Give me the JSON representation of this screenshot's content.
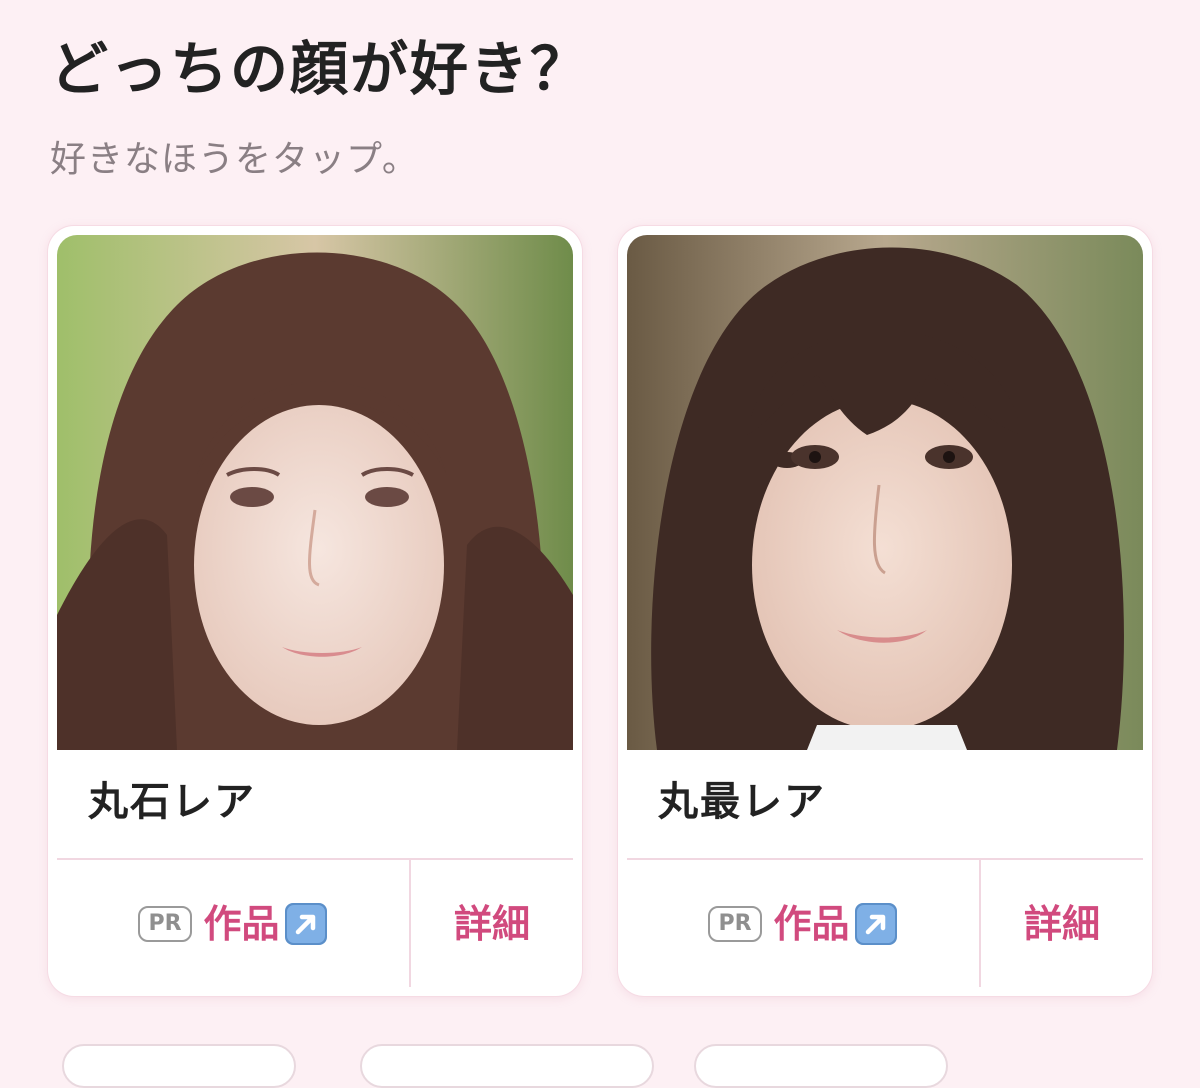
{
  "header": {
    "title": "どっちの顔が好き？",
    "subtitle": "好きなほうをタップ。"
  },
  "cards": [
    {
      "name": "丸石レア",
      "pr_label": "PR",
      "works_label": "作品",
      "works_icon": "up-right-arrow-icon",
      "detail_label": "詳細"
    },
    {
      "name": "丸最レア",
      "pr_label": "PR",
      "works_label": "作品",
      "works_icon": "up-right-arrow-icon",
      "detail_label": "詳細"
    }
  ],
  "colors": {
    "background": "#fdf0f4",
    "accent": "#d14a7e",
    "title": "#222222",
    "subtitle": "#8a7f84",
    "divider": "#f1d7e1"
  }
}
